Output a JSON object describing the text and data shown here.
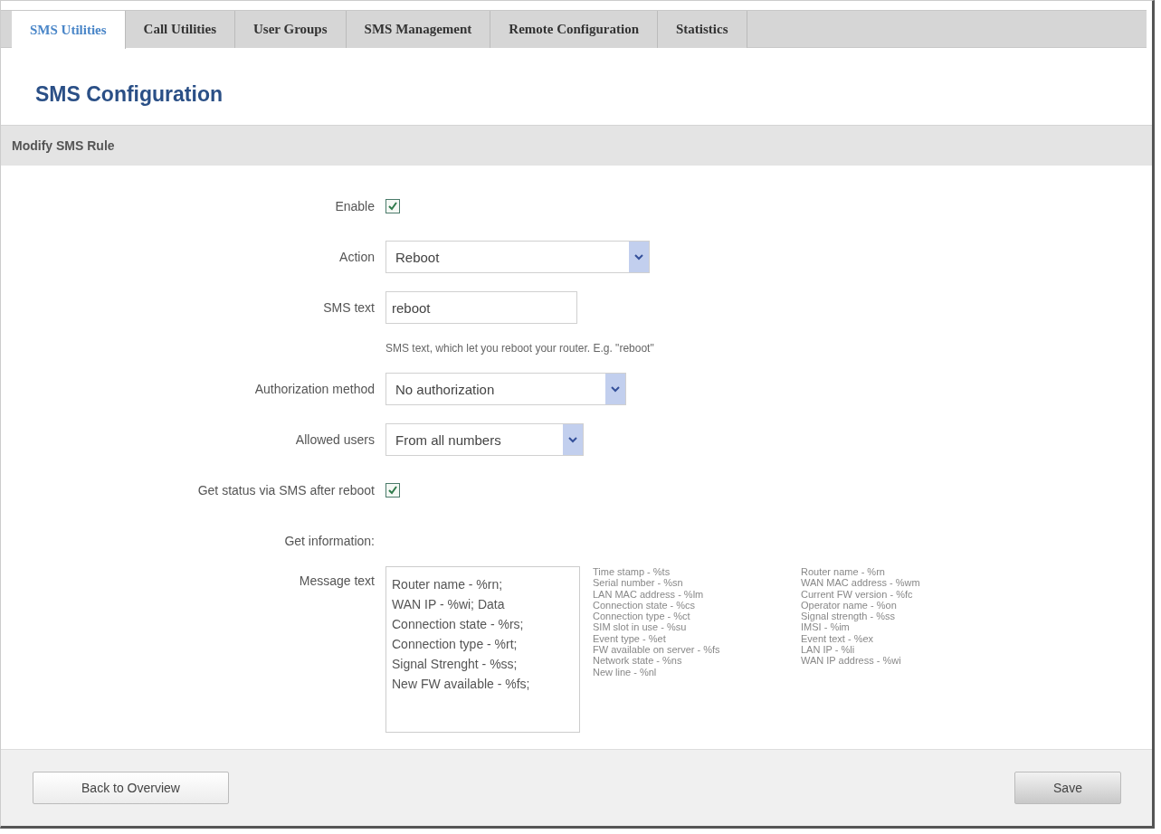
{
  "tabs": [
    {
      "label": "SMS Utilities",
      "selected": true
    },
    {
      "label": "Call Utilities",
      "selected": false
    },
    {
      "label": "User Groups",
      "selected": false
    },
    {
      "label": "SMS Management",
      "selected": false
    },
    {
      "label": "Remote Configuration",
      "selected": false
    },
    {
      "label": "Statistics",
      "selected": false
    }
  ],
  "heading": "SMS Configuration",
  "section_title": "Modify SMS Rule",
  "fields": [
    {
      "kind": "checkbox",
      "label": "Enable",
      "checked": true
    },
    {
      "kind": "select",
      "label": "Action",
      "value": "Reboot"
    },
    {
      "kind": "text",
      "label": "SMS text",
      "value": "reboot"
    },
    {
      "kind": "hint",
      "text": "SMS text, which let you reboot your router. E.g. \"reboot\""
    },
    {
      "kind": "select",
      "label": "Authorization method",
      "value": "No authorization"
    },
    {
      "kind": "select",
      "label": "Allowed users",
      "value": "From all numbers"
    },
    {
      "kind": "checkbox",
      "label": "Get status via SMS after reboot",
      "checked": true
    },
    {
      "kind": "caption",
      "label": "Get information:"
    },
    {
      "kind": "textarea",
      "label": "Message text",
      "value": "Router name - %rn;\nWAN IP - %wi; Data\nConnection state - %rs;\nConnection type - %rt;\nSignal Strenght - %ss;\nNew FW available - %fs;"
    }
  ],
  "variables": [
    [
      "Time stamp - %ts",
      "Serial number - %sn",
      "LAN MAC address - %lm",
      "Connection state - %cs",
      "Connection type - %ct",
      "SIM slot in use - %su",
      "Event type - %et",
      "FW available on server - %fs",
      "Network state - %ns",
      "New line - %nl"
    ],
    [
      "Router name - %rn",
      "WAN MAC address - %wm",
      "Current FW version - %fc",
      "Operator name - %on",
      "Signal strength - %ss",
      "IMSI - %im",
      "Event text - %ex",
      "LAN IP - %li",
      "WAN IP address - %wi"
    ]
  ],
  "buttons": [
    {
      "label": "Back to Overview",
      "kind": "back"
    },
    {
      "label": "Save",
      "kind": "save"
    }
  ]
}
